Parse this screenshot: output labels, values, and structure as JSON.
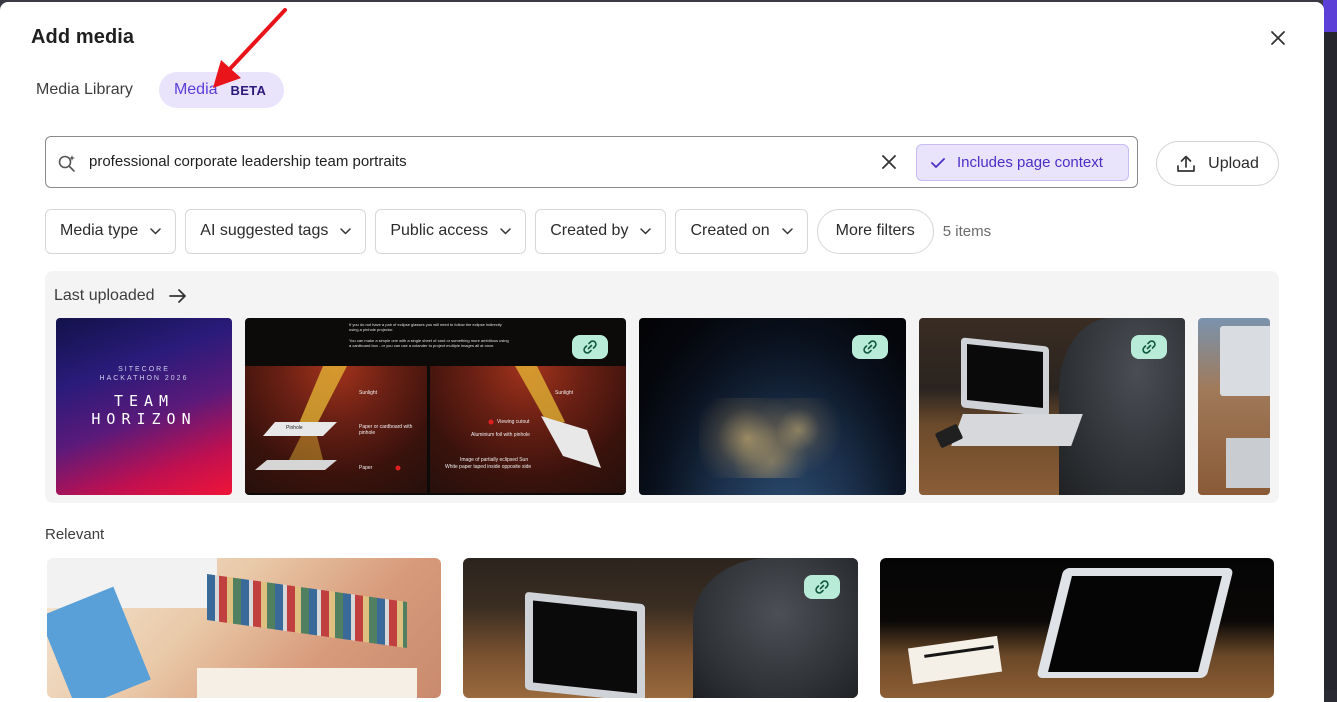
{
  "dialog": {
    "title": "Add media",
    "close_icon": "close-icon"
  },
  "tabs": [
    {
      "label": "Media Library",
      "active": false
    },
    {
      "label": "Media",
      "active": true,
      "badge": "BETA"
    }
  ],
  "search": {
    "query": "professional corporate leadership team portraits",
    "icon": "ai-search-icon",
    "context_chip": "Includes page context"
  },
  "upload": {
    "label": "Upload",
    "icon": "upload-icon"
  },
  "filters": [
    {
      "label": "Media type"
    },
    {
      "label": "AI suggested tags"
    },
    {
      "label": "Public access"
    },
    {
      "label": "Created by"
    },
    {
      "label": "Created on"
    }
  ],
  "more_filters": "More filters",
  "item_count": "5 items",
  "last_uploaded": {
    "title": "Last uploaded",
    "thumb1": {
      "line1": "SITECORE",
      "line2": "HACKATHON 2026",
      "line3": "TEAM",
      "line4": "HORIZON"
    },
    "thumb2": {
      "text1": "If you do not have a pair of eclipse glasses you will need to follow the eclipse indirectly using a pinhole projector.",
      "text2": "You can make a simple one with a single sheet of card or something more ambitious using a cardboard box - or you can use a colander to project multiple images all at once.",
      "sunlight": "Sunlight",
      "pinhole": "Pinhole",
      "paper_card": "Paper or cardboard with pinhole",
      "paper": "Paper",
      "viewing_cutout": "Viewing cutout",
      "foil": "Aluminium foil with pinhole",
      "image_partial": "Image of partially eclipsed Sun",
      "white_paper": "White paper taped inside opposite side"
    }
  },
  "relevant": {
    "title": "Relevant"
  },
  "colors": {
    "accent": "#5b3fd6",
    "accent_bg": "#e9e3fb",
    "link_badge": "#b9ecd8"
  }
}
